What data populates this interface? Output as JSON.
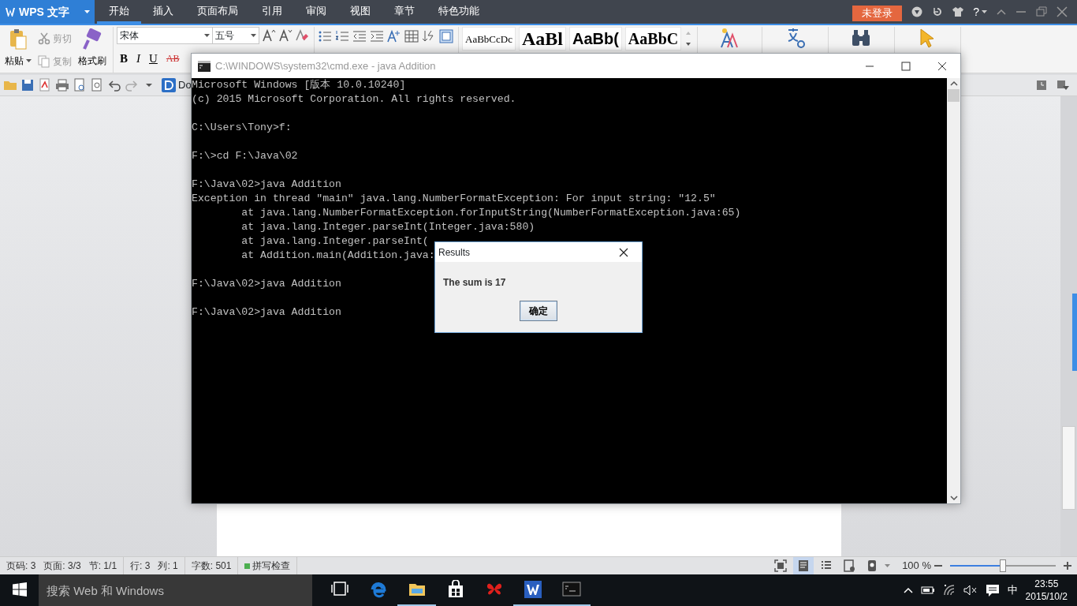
{
  "wps": {
    "app_menu": "WPS 文字",
    "tabs": [
      {
        "label": "开始",
        "selected": true
      },
      {
        "label": "插入",
        "selected": false
      },
      {
        "label": "页面布局",
        "selected": false
      },
      {
        "label": "引用",
        "selected": false
      },
      {
        "label": "审阅",
        "selected": false
      },
      {
        "label": "视图",
        "selected": false
      },
      {
        "label": "章节",
        "selected": false
      },
      {
        "label": "特色功能",
        "selected": false
      }
    ],
    "login_button": "未登录",
    "help_label": "?",
    "clipboard": [
      {
        "kind": "paste",
        "label": "粘贴",
        "disabled": false
      },
      {
        "kind": "cut",
        "label": "剪切",
        "disabled": true
      },
      {
        "kind": "copy",
        "label": "复制",
        "disabled": true
      },
      {
        "kind": "painter",
        "label": "格式刷",
        "disabled": false
      }
    ],
    "font": {
      "name": "宋体",
      "size": "五号"
    },
    "format_buttons": [
      {
        "kind": "bold",
        "label": "B"
      },
      {
        "kind": "italic",
        "label": "I"
      },
      {
        "kind": "underline",
        "label": "U"
      },
      {
        "kind": "strike",
        "label": "AB"
      }
    ],
    "styles": [
      {
        "kind": "normal",
        "label": "AaBbCcDc"
      },
      {
        "kind": "heading1",
        "label": "AaBl"
      },
      {
        "kind": "heading2",
        "label": "AaBb("
      },
      {
        "kind": "heading3",
        "label": "AaBbC"
      }
    ],
    "doc_tab": "Do",
    "status": {
      "groups": [
        [
          "页码: 3",
          "页面: 3/3",
          "节: 1/1"
        ],
        [
          "行: 3",
          "列: 1"
        ],
        [
          "字数: 501"
        ]
      ],
      "spell_check": "拼写检查",
      "view_modes": [
        {
          "kind": "fullscreen",
          "selected": false
        },
        {
          "kind": "page",
          "selected": true
        },
        {
          "kind": "outline",
          "selected": false
        },
        {
          "kind": "web",
          "selected": false
        },
        {
          "kind": "reading",
          "selected": false
        }
      ],
      "zoom": "100 %",
      "zoom_slider": {
        "level": 0.5
      }
    }
  },
  "cmd_window": {
    "title": "C:\\WINDOWS\\system32\\cmd.exe - java  Addition",
    "blocks": [
      [
        "Microsoft Windows [版本 10.0.10240]",
        "(c) 2015 Microsoft Corporation. All rights reserved."
      ],
      [
        "C:\\Users\\Tony>f:"
      ],
      [
        "F:\\>cd F:\\Java\\02"
      ],
      [
        "F:\\Java\\02>java Addition",
        "Exception in thread \"main\" java.lang.NumberFormatException: For input string: \"12.5\"",
        "        at java.lang.NumberFormatException.forInputString(NumberFormatException.java:65)",
        "        at java.lang.Integer.parseInt(Integer.java:580)",
        "        at java.lang.Integer.parseInt(",
        "        at Addition.main(Addition.java:"
      ],
      [
        "F:\\Java\\02>java Addition"
      ],
      [
        "F:\\Java\\02>java Addition"
      ]
    ]
  },
  "dialog": {
    "title": "Results",
    "message": "The sum is 17",
    "button": "确定"
  },
  "taskbar": {
    "search_placeholder": "搜索 Web 和 Windows",
    "apps": [
      {
        "kind": "task-view",
        "running": false
      },
      {
        "kind": "browser",
        "running": false
      },
      {
        "kind": "folder",
        "running": true
      },
      {
        "kind": "store",
        "running": false
      },
      {
        "kind": "butterfly",
        "running": false
      },
      {
        "kind": "writer",
        "running": true
      },
      {
        "kind": "console",
        "running": true
      }
    ],
    "ime": "中",
    "time": "23:55",
    "date": "2015/10/2"
  }
}
